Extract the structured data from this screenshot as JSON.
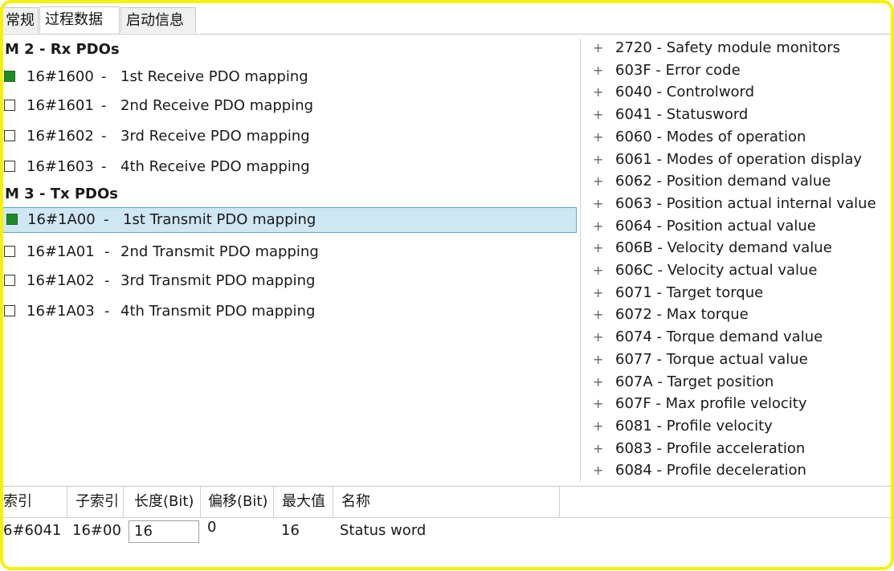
{
  "tabs": [
    {
      "label": "常规"
    },
    {
      "label": "过程数据"
    },
    {
      "label": "启动信息"
    }
  ],
  "rx_group": {
    "title": "M 2 - Rx PDOs",
    "items": [
      {
        "index": "16#1600",
        "sep": "-",
        "name": "1st Receive PDO mapping",
        "checked": true
      },
      {
        "index": "16#1601",
        "sep": "-",
        "name": "2nd Receive PDO mapping",
        "checked": false
      },
      {
        "index": "16#1602",
        "sep": "-",
        "name": "3rd Receive PDO mapping",
        "checked": false
      },
      {
        "index": "16#1603",
        "sep": "-",
        "name": "4th Receive PDO mapping",
        "checked": false
      }
    ]
  },
  "tx_group": {
    "title": "M 3 - Tx PDOs",
    "items": [
      {
        "index": "16#1A00",
        "sep": "-",
        "name": "1st Transmit PDO mapping",
        "checked": true
      },
      {
        "index": "16#1A01",
        "sep": "-",
        "name": "2nd Transmit PDO mapping",
        "checked": false
      },
      {
        "index": "16#1A02",
        "sep": "-",
        "name": "3rd Transmit PDO mapping",
        "checked": false
      },
      {
        "index": "16#1A03",
        "sep": "-",
        "name": "4th Transmit PDO mapping",
        "checked": false
      }
    ]
  },
  "objects": [
    "2720 - Safety module monitors",
    "603F - Error code",
    "6040 - Controlword",
    "6041 - Statusword",
    "6060 - Modes of operation",
    "6061 - Modes of operation display",
    "6062 - Position demand value",
    "6063 - Position actual internal value",
    "6064 - Position actual value",
    "606B - Velocity demand value",
    "606C - Velocity actual value",
    "6071 - Target torque",
    "6072 - Max torque",
    "6074 - Torque demand value",
    "6077 - Torque actual value",
    "607A - Target position",
    "607F - Max profile velocity",
    "6081 - Profile velocity",
    "6083 - Profile acceleration",
    "6084 - Profile deceleration"
  ],
  "plus_glyph": "+",
  "table": {
    "headers": [
      "索引",
      "子索引",
      "长度(Bit)",
      "偏移(Bit)",
      "最大值",
      "名称"
    ],
    "row": {
      "index": "6#6041",
      "subindex": "16#00",
      "length": "16",
      "offset": "0",
      "max": "16",
      "name": "Status word"
    }
  },
  "colors": {
    "selection_bg": "#cfe6f3",
    "selection_border": "#5aa6d6",
    "checked": "#1e8a2a",
    "frame": "#f4f20a"
  }
}
